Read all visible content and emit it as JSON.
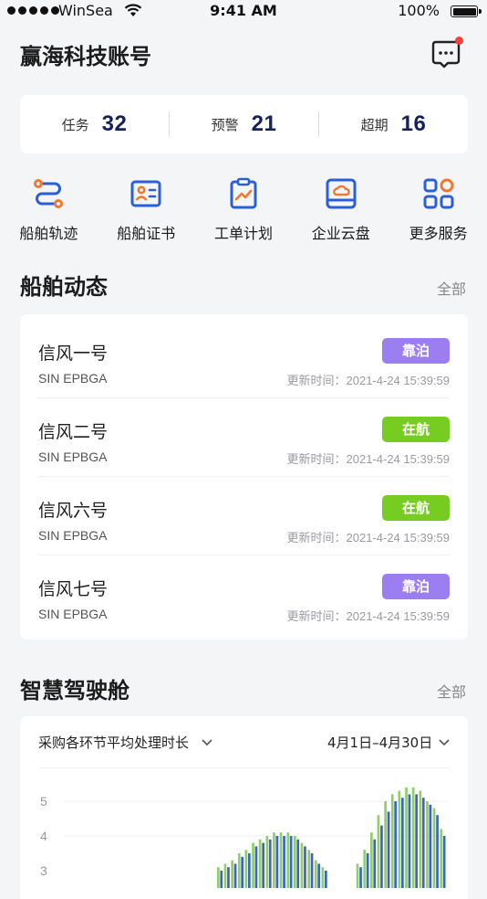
{
  "status_bar": {
    "carrier": "WinSea",
    "time": "9:41 AM",
    "battery": "100%"
  },
  "header": {
    "title": "赢海科技账号"
  },
  "stats": [
    {
      "label": "任务",
      "value": "32"
    },
    {
      "label": "预警",
      "value": "21"
    },
    {
      "label": "超期",
      "value": "16"
    }
  ],
  "quick_actions": [
    {
      "label": "船舶轨迹",
      "icon": "track-icon"
    },
    {
      "label": "船舶证书",
      "icon": "certificate-icon"
    },
    {
      "label": "工单计划",
      "icon": "clipboard-chart-icon"
    },
    {
      "label": "企业云盘",
      "icon": "cloud-drive-icon"
    },
    {
      "label": "更多服务",
      "icon": "grid-icon"
    }
  ],
  "ships_section": {
    "title": "船舶动态",
    "more": "全部",
    "items": [
      {
        "name": "信风一号",
        "code": "SIN EPBGA",
        "status": "靠泊",
        "time": "更新时间：2021-4-24 15:39:59"
      },
      {
        "name": "信风二号",
        "code": "SIN EPBGA",
        "status": "在航",
        "time": "更新时间：2021-4-24 15:39:59"
      },
      {
        "name": "信风六号",
        "code": "SIN EPBGA",
        "status": "在航",
        "time": "更新时间：2021-4-24 15:39:59"
      },
      {
        "name": "信风七号",
        "code": "SIN EPBGA",
        "status": "靠泊",
        "time": "更新时间：2021-4-24 15:39:59"
      }
    ]
  },
  "cockpit_section": {
    "title": "智慧驾驶舱",
    "more": "全部",
    "metric_select": "采购各环节平均处理时长",
    "date_range": "4月1日–4月30日"
  },
  "colors": {
    "accent": "#2b5fd9",
    "orange": "#f07830",
    "berth": "#9b7ff0",
    "sailing": "#77cc22",
    "title_num": "#14215a"
  },
  "chart_data": {
    "type": "bar",
    "yticks": [
      "5",
      "4"
    ],
    "ylim": [
      2.5,
      5.5
    ],
    "series": [
      {
        "values": [
          0,
          0,
          0,
          0,
          0,
          0,
          0,
          0,
          0,
          0,
          0,
          0,
          0,
          0,
          0,
          0,
          0,
          0,
          0,
          0,
          0,
          0,
          3.1,
          3.2,
          3.3,
          3.5,
          3.6,
          3.8,
          3.9,
          4.0,
          4.1,
          4.1,
          4.1,
          4.0,
          3.8,
          3.6,
          3.3,
          3.1,
          0,
          0,
          0,
          0,
          3.2,
          3.6,
          4.1,
          4.6,
          5.0,
          5.2,
          5.3,
          5.4,
          5.4,
          5.3,
          5.0,
          4.8,
          4.2
        ]
      },
      {
        "values": [
          0,
          0,
          0,
          0,
          0,
          0,
          0,
          0,
          0,
          0,
          0,
          0,
          0,
          0,
          0,
          0,
          0,
          0,
          0,
          0,
          0,
          0,
          3.0,
          3.1,
          3.2,
          3.4,
          3.5,
          3.7,
          3.8,
          3.9,
          4.0,
          4.0,
          4.0,
          3.9,
          3.7,
          3.5,
          3.2,
          3.0,
          0,
          0,
          0,
          0,
          3.1,
          3.5,
          3.9,
          4.3,
          4.7,
          5.0,
          5.1,
          5.2,
          5.2,
          5.1,
          4.9,
          4.6,
          4.0
        ]
      }
    ]
  }
}
